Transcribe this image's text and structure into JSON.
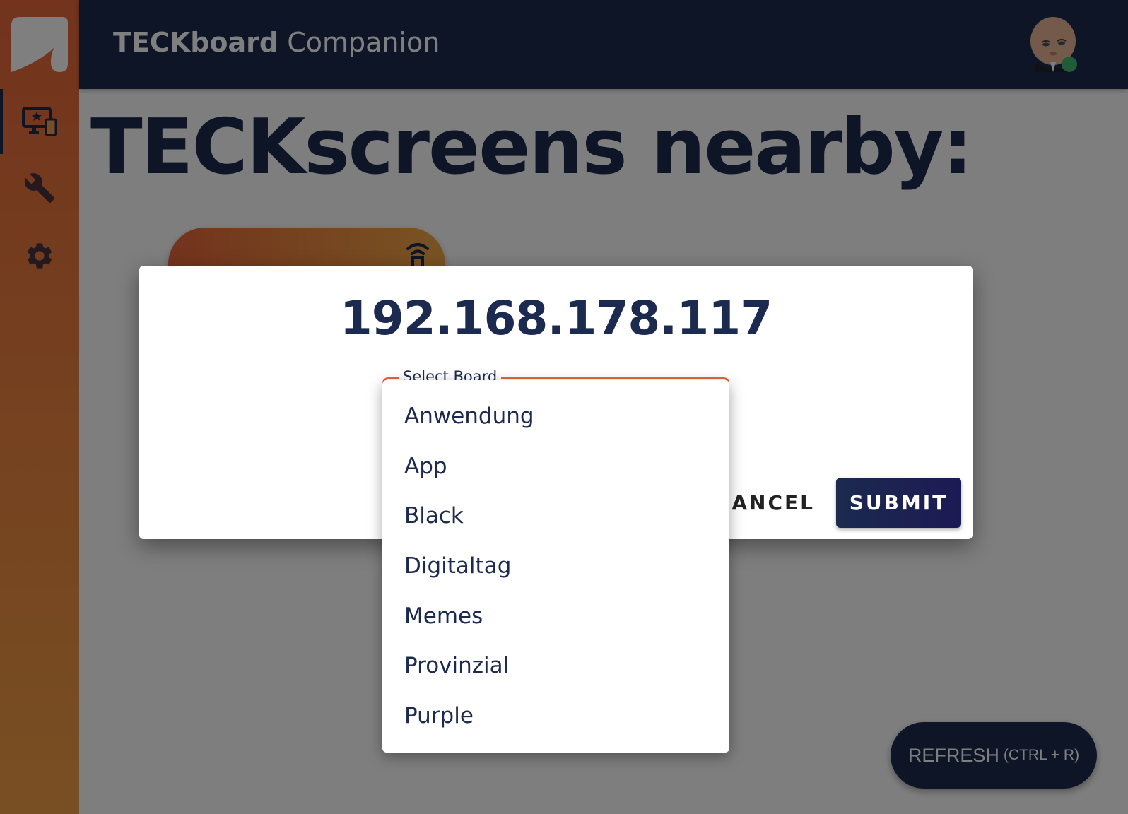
{
  "header": {
    "app_title_bold": "TECKboard",
    "app_title_regular": "Companion",
    "user_status": "online"
  },
  "sidebar": {
    "items": [
      {
        "name": "screens",
        "icon": "monitor-devices-icon",
        "active": true
      },
      {
        "name": "tools",
        "icon": "wrench-icon",
        "active": false
      },
      {
        "name": "settings",
        "icon": "gear-icon",
        "active": false
      }
    ]
  },
  "main": {
    "page_title": "TECKscreens nearby:",
    "refresh_label": "REFRESH",
    "refresh_shortcut": "(CTRL + R)"
  },
  "dialog": {
    "title": "192.168.178.117",
    "select_label": "Select Board",
    "cancel_label": "CANCEL",
    "submit_label": "SUBMIT"
  },
  "menu": {
    "options": [
      "Anwendung",
      "App",
      "Black",
      "Digitaltag",
      "Memes",
      "Provinzial",
      "Purple"
    ]
  },
  "colors": {
    "navy": "#1b2a4e",
    "accent": "#e6673a",
    "accent_end": "#f1a845",
    "status_online": "#3fb96f"
  }
}
